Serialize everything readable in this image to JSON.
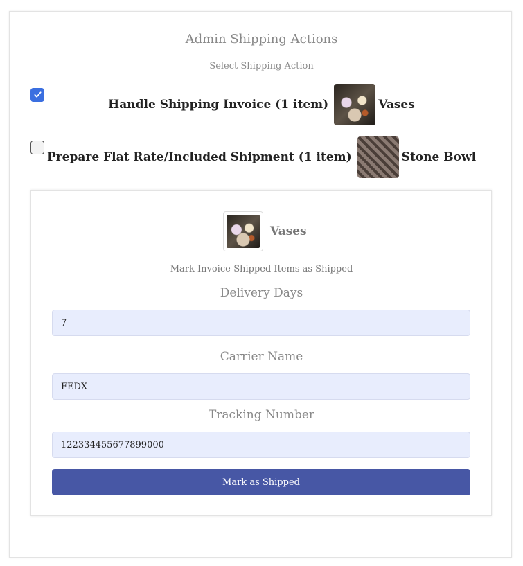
{
  "page": {
    "title": "Admin Shipping Actions",
    "subtitle": "Select Shipping Action"
  },
  "options": [
    {
      "label": "Handle Shipping Invoice (1 item)",
      "item_name": "Vases",
      "checked": true,
      "thumbnail": "vases-photo"
    },
    {
      "label": "Prepare Flat Rate/Included Shipment (1 item)",
      "item_name": "Stone Bowl",
      "checked": false,
      "thumbnail": "stone-bowl-photo"
    }
  ],
  "form": {
    "item_name": "Vases",
    "instructions": "Mark Invoice-Shipped Items as Shipped",
    "delivery_days": {
      "label": "Delivery Days",
      "value": "7"
    },
    "carrier_name": {
      "label": "Carrier Name",
      "value": "FEDX"
    },
    "tracking_number": {
      "label": "Tracking Number",
      "value": "122334455677899000"
    },
    "submit_label": "Mark as Shipped"
  },
  "colors": {
    "checkbox_checked": "#3b6fe0",
    "input_background": "#e8edfd",
    "button_background": "#4757a5"
  }
}
